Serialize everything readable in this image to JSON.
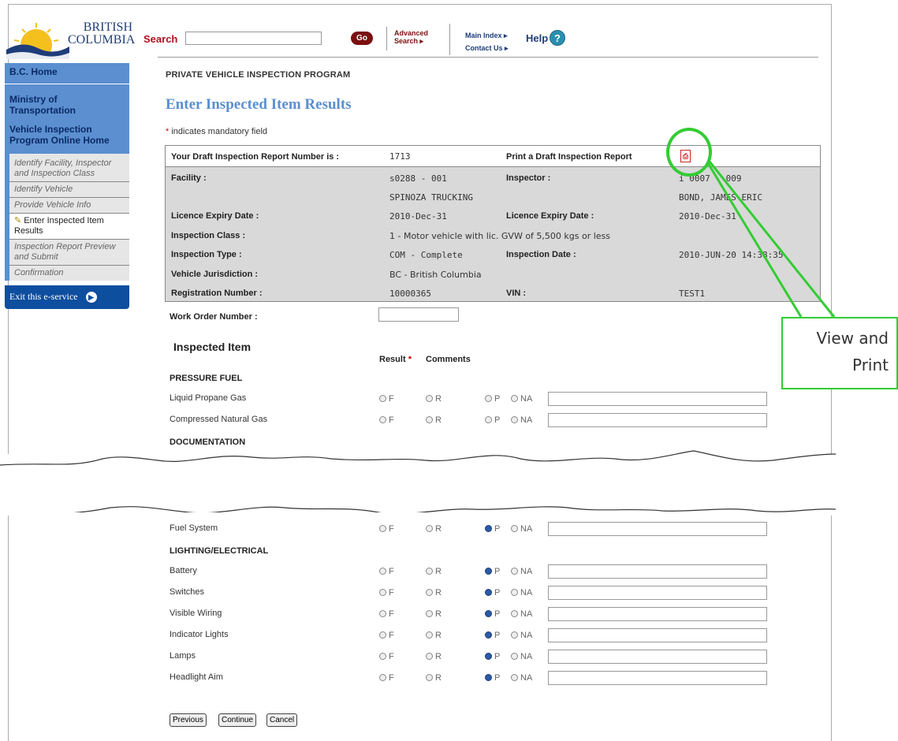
{
  "header": {
    "logo_line1": "BRITISH",
    "logo_line2": "COLUMBIA",
    "search_label": "Search",
    "search_placeholder": "",
    "go_label": "Go",
    "advanced_line1": "Advanced",
    "advanced_line2": "Search ▸",
    "main_index": "Main Index ▸",
    "contact_us": "Contact Us ▸",
    "help": "Help",
    "help_icon": "?"
  },
  "sidebar": {
    "links": [
      "B.C. Home",
      "Ministry of Transportation",
      "Vehicle Inspection Program Online Home"
    ],
    "steps": [
      "Identify Facility, Inspector and Inspection Class",
      "Identify Vehicle",
      "Provide Vehicle Info",
      "Enter Inspected Item Results",
      "Inspection Report Preview and Submit",
      "Confirmation"
    ],
    "current_step_index": 3,
    "exit_label": "Exit this e-service"
  },
  "main": {
    "program": "PRIVATE VEHICLE INSPECTION PROGRAM",
    "title": "Enter Inspected Item Results",
    "mandatory_star": "*",
    "mandatory_text": " indicates mandatory field",
    "report_label": "Your Draft Inspection Report Number is :",
    "report_number": "1713",
    "print_label": "Print a Draft Inspection Report",
    "pdf_icon": "pdf-icon",
    "facility_label": "Facility :",
    "facility_code": "s0288 - 001",
    "facility_name": "SPINOZA TRUCKING",
    "inspector_label": "Inspector :",
    "inspector_code": "i 0007 - 009",
    "inspector_name": "BOND, JAMES ERIC",
    "licence_label": "Licence Expiry Date :",
    "facility_licence": "2010-Dec-31",
    "inspector_licence_label": "Licence Expiry Date :",
    "inspector_licence": "2010-Dec-31",
    "class_label": "Inspection Class :",
    "class_value": "1 - Motor vehicle with lic. GVW of 5,500 kgs or less",
    "type_label": "Inspection Type :",
    "type_value": "COM - Complete",
    "date_label": "Inspection Date :",
    "date_value": "2010-JUN-20 14:38:35",
    "jurisdiction_label": "Vehicle Jurisdiction :",
    "jurisdiction_value": "BC - British Columbia",
    "registration_label": "Registration Number :",
    "registration_value": "10000365",
    "vin_label": "VIN :",
    "vin_value": "TEST1",
    "work_order_label": "Work Order Number :",
    "work_order_value": "",
    "section_header": "Inspected Item",
    "result_header": "Result",
    "result_star": "*",
    "comments_header": "Comments",
    "radio_labels": [
      "F",
      "R",
      "P",
      "NA"
    ]
  },
  "groups_top": [
    {
      "name": "PRESSURE FUEL",
      "items": [
        {
          "label": "Liquid Propane Gas",
          "selected": null
        },
        {
          "label": "Compressed Natural Gas",
          "selected": null
        }
      ]
    },
    {
      "name": "DOCUMENTATION",
      "items": []
    }
  ],
  "groups_bottom": [
    {
      "name": "",
      "items": [
        {
          "label": "Fuel System",
          "selected": "P"
        }
      ]
    },
    {
      "name": "LIGHTING/ELECTRICAL",
      "items": [
        {
          "label": "Battery",
          "selected": "P"
        },
        {
          "label": "Switches",
          "selected": "P"
        },
        {
          "label": "Visible Wiring",
          "selected": "P"
        },
        {
          "label": "Indicator Lights",
          "selected": "P"
        },
        {
          "label": "Lamps",
          "selected": "P"
        },
        {
          "label": "Headlight Aim",
          "selected": "P"
        }
      ]
    }
  ],
  "buttons": {
    "previous": "Previous",
    "continue": "Continue",
    "cancel": "Cancel"
  },
  "annotation": {
    "line1": "View and",
    "line2": "Print",
    "color": "#33cc33"
  }
}
